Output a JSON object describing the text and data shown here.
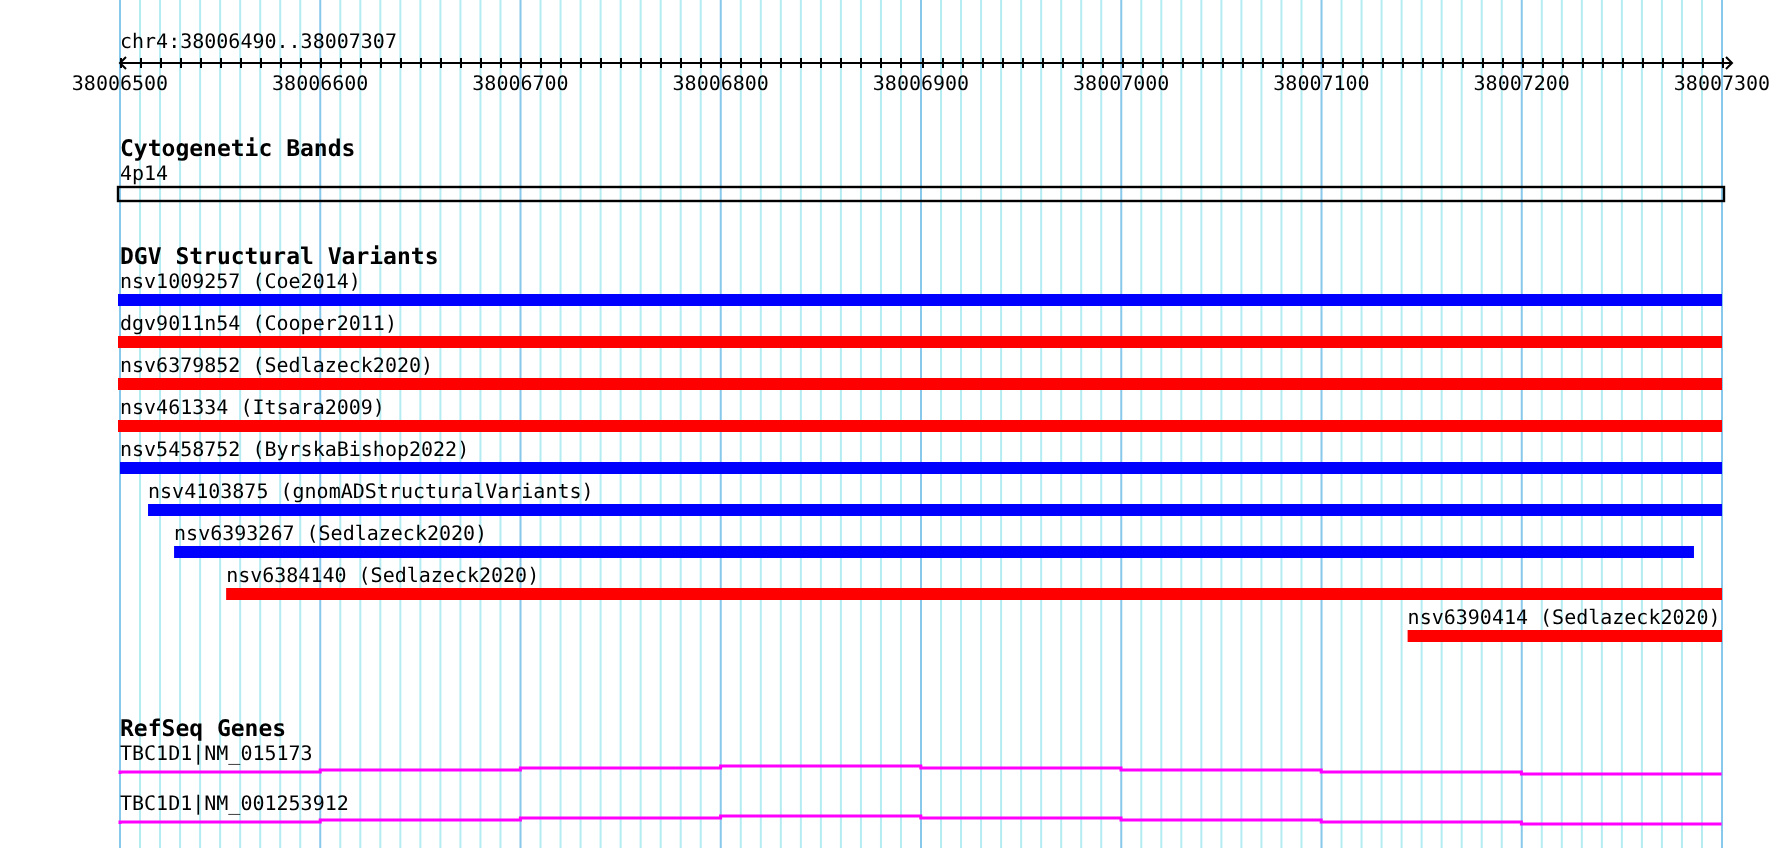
{
  "location": "chr4:38006490..38007307",
  "ruler": {
    "labels": [
      "38006500",
      "38006600",
      "38006700",
      "38006800",
      "38006900",
      "38007000",
      "38007100",
      "38007200",
      "38007300"
    ]
  },
  "tracks": [
    {
      "kind": "bands",
      "title": "Cytogenetic Bands",
      "features": [
        {
          "label": "4p14"
        }
      ]
    },
    {
      "kind": "variants",
      "title": "DGV Structural Variants",
      "features": [
        {
          "label": "nsv1009257 (Coe2014)",
          "color": "#0000ff"
        },
        {
          "label": "dgv9011n54 (Cooper2011)",
          "color": "#ff0000"
        },
        {
          "label": "nsv6379852 (Sedlazeck2020)",
          "color": "#ff0000"
        },
        {
          "label": "nsv461334 (Itsara2009)",
          "color": "#ff0000"
        },
        {
          "label": "nsv5458752 (ByrskaBishop2022)",
          "color": "#0000ff"
        },
        {
          "label": "nsv4103875 (gnomADStructuralVariants)",
          "color": "#0000ff"
        },
        {
          "label": "nsv6393267 (Sedlazeck2020)",
          "color": "#0000ff"
        },
        {
          "label": "nsv6384140 (Sedlazeck2020)",
          "color": "#ff0000"
        },
        {
          "label": "nsv6390414 (Sedlazeck2020)",
          "color": "#ff0000"
        }
      ]
    },
    {
      "kind": "genes",
      "title": "RefSeq Genes",
      "features": [
        {
          "label": "TBC1D1|NM_015173"
        },
        {
          "label": "TBC1D1|NM_001253912"
        }
      ]
    }
  ]
}
